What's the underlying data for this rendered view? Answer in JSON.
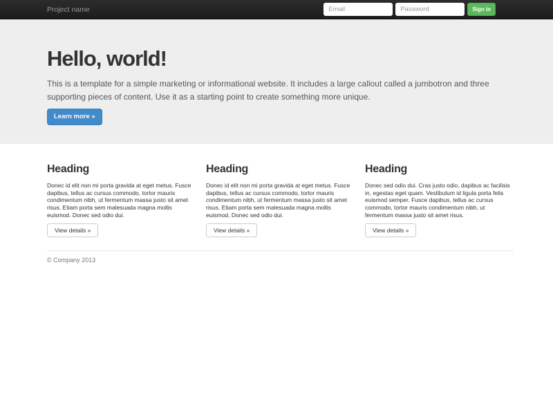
{
  "navbar": {
    "brand": "Project name",
    "email_placeholder": "Email",
    "password_placeholder": "Password",
    "signin_label": "Sign in"
  },
  "jumbotron": {
    "title": "Hello, world!",
    "description": "This is a template for a simple marketing or informational website. It includes a large callout called a jumbotron and three supporting pieces of content. Use it as a starting point to create something more unique.",
    "cta_label": "Learn more »"
  },
  "columns": [
    {
      "heading": "Heading",
      "text": "Donec id elit non mi porta gravida at eget metus. Fusce dapibus, tellus ac cursus commodo, tortor mauris condimentum nibh, ut fermentum massa justo sit amet risus. Etiam porta sem malesuada magna mollis euismod. Donec sed odio dui.",
      "button_label": "View details »"
    },
    {
      "heading": "Heading",
      "text": "Donec id elit non mi porta gravida at eget metus. Fusce dapibus, tellus ac cursus commodo, tortor mauris condimentum nibh, ut fermentum massa justo sit amet risus. Etiam porta sem malesuada magna mollis euismod. Donec sed odio dui.",
      "button_label": "View details »"
    },
    {
      "heading": "Heading",
      "text": "Donec sed odio dui. Cras justo odio, dapibus ac facilisis in, egestas eget quam. Vestibulum id ligula porta felis euismod semper. Fusce dapibus, tellus ac cursus commodo, tortor mauris condimentum nibh, ut fermentum massa justo sit amet risus.",
      "button_label": "View details »"
    }
  ],
  "footer": {
    "copyright": "© Company 2013"
  },
  "colors": {
    "navbar_bg": "#222222",
    "jumbotron_bg": "#eeeeee",
    "primary_button": "#428bca",
    "primary_button_border": "#357ebd",
    "success_button": "#5cb85c",
    "success_button_border": "#4cae4c",
    "muted_text": "#777777"
  }
}
